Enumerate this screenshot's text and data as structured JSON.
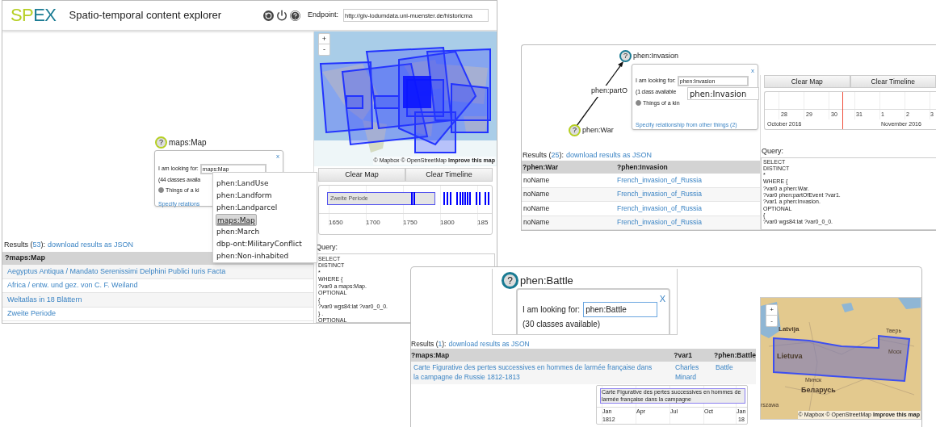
{
  "main_window": {
    "logo": {
      "part_1": "SP",
      "part_2": "EX"
    },
    "title": "Spatio-temporal content explorer",
    "endpoint": {
      "label": "Endpoint:",
      "value": "http://giv-lodumdata.uni-muenster.de/historicma"
    },
    "node": {
      "mark": "?",
      "label": "maps:Map",
      "selected": false
    },
    "popup": {
      "close": "x",
      "label": "I am looking for:",
      "value": "maps:Map",
      "available": "(44 classes availa",
      "radio_label": "Things of a ki",
      "radio_selected": true,
      "link": "Specify relations"
    },
    "dropdown": [
      {
        "label": "phen:LandUse",
        "selected": false
      },
      {
        "label": "phen:Landform",
        "selected": false
      },
      {
        "label": "phen:Landparcel",
        "selected": false
      },
      {
        "label": "maps:Map",
        "selected": true
      },
      {
        "label": "phen:March",
        "selected": false
      },
      {
        "label": "dbp-ont:MilitaryConflict",
        "selected": false
      },
      {
        "label": "phen:Non-inhabited",
        "selected": false
      }
    ],
    "map": {
      "zoom_in": "+",
      "zoom_out": "-",
      "attribution": "© Mapbox © OpenStreetMap",
      "attribution_link": "Improve this map"
    },
    "buttons": [
      "Clear Map",
      "Clear Timeline"
    ],
    "timeline": {
      "item": "Zweite Periode",
      "ticks": [
        "1650",
        "1700",
        "1750",
        "1800",
        "185"
      ]
    },
    "results": {
      "before": "Results (",
      "count": "53",
      "after": "):",
      "link": "download results as JSON"
    },
    "table": {
      "columns": [
        "?maps:Map"
      ],
      "rows": [
        [
          "Aegyptus Antiqua / Mandato Serenissimi Delphini Publici Iuris Facta"
        ],
        [
          "Africa / entw. und gez. von C. F. Weiland"
        ],
        [
          "Weltatlas in 18 Blättern"
        ],
        [
          "Zweite Periode"
        ]
      ]
    },
    "query": {
      "label": "Query:",
      "lines": [
        "SELECT",
        "DISTINCT",
        "*",
        "WHERE {",
        "?var0 a maps:Map.",
        "OPTIONAL",
        "{",
        "?var0 wgs84:lat ?var0_0_0.",
        "} .",
        "OPTIONAL"
      ]
    }
  },
  "war_window": {
    "nodes": [
      {
        "mark": "?",
        "label": "phen:Invasion",
        "selected": true
      },
      {
        "mark": "?",
        "label": "phen:War",
        "selected": false
      }
    ],
    "edge_label": "phen:partO",
    "popup": {
      "close": "x",
      "label": "I am looking for:",
      "value": "phen:Invasion",
      "available": "(1 class available",
      "option": "phen:Invasion",
      "radio_label": "Things of a kin",
      "radio_selected": true,
      "link": "Specify relationship from other things (2)"
    },
    "buttons": [
      "Clear Map",
      "Clear Timeline"
    ],
    "timeline": {
      "days": [
        "28",
        "29",
        "30",
        "31",
        "1",
        "2",
        "3"
      ],
      "months": [
        "October 2016",
        "November 2016"
      ]
    },
    "results": {
      "before": "Results (",
      "count": "25",
      "after": "):",
      "link": "download results as JSON"
    },
    "table": {
      "columns": [
        "?phen:War",
        "?phen:Invasion"
      ],
      "rows": [
        [
          "noName",
          "French_invasion_of_Russia"
        ],
        [
          "noName",
          "French_invasion_of_Russia"
        ],
        [
          "noName",
          "French_invasion_of_Russia"
        ],
        [
          "noName",
          "French_invasion_of_Russia"
        ]
      ]
    },
    "query": {
      "label": "Query:",
      "lines": [
        "SELECT",
        "DISTINCT",
        "*",
        "WHERE {",
        "?var0 a phen:War.",
        "?var0 phen:partOfEvent ?var1.",
        "?var1 a phen:Invasion.",
        "OPTIONAL",
        "{",
        "?var0 wgs84:lat ?var0_0_0."
      ]
    }
  },
  "battle_window": {
    "node": {
      "mark": "?",
      "label": "phen:Battle",
      "selected": true
    },
    "popup": {
      "close": "X",
      "label": "I am looking for:",
      "value": "phen:Battle",
      "available": "(30 classes available)"
    },
    "results": {
      "before": "Results (",
      "count": "1",
      "after": "):",
      "link": "download results as JSON"
    },
    "table": {
      "columns": [
        "?maps:Map",
        "?var1",
        "?phen:Battle"
      ],
      "rows": [
        [
          "Carte Figurative des pertes successives en hommes de larmée française dans la campagne de Russie 1812-1813",
          "Charles Minard",
          "Battle"
        ]
      ]
    },
    "mini_timeline": {
      "item": "Carte Figurative des pertes successives en hommes de larmée française dans la campagne",
      "months": [
        "Jan",
        "Apr",
        "Jul",
        "Oct",
        "Jan"
      ],
      "years": [
        "1812",
        "18"
      ]
    },
    "map": {
      "zoom_in": "+",
      "zoom_out": "-",
      "labels": [
        "Latvija",
        "Тверь",
        "Lietuva",
        "Моск",
        "Минск",
        "Беларусь",
        "rszawa"
      ],
      "attribution": "© Mapbox © OpenStreetMap",
      "attribution_link": "Improve this map"
    }
  }
}
